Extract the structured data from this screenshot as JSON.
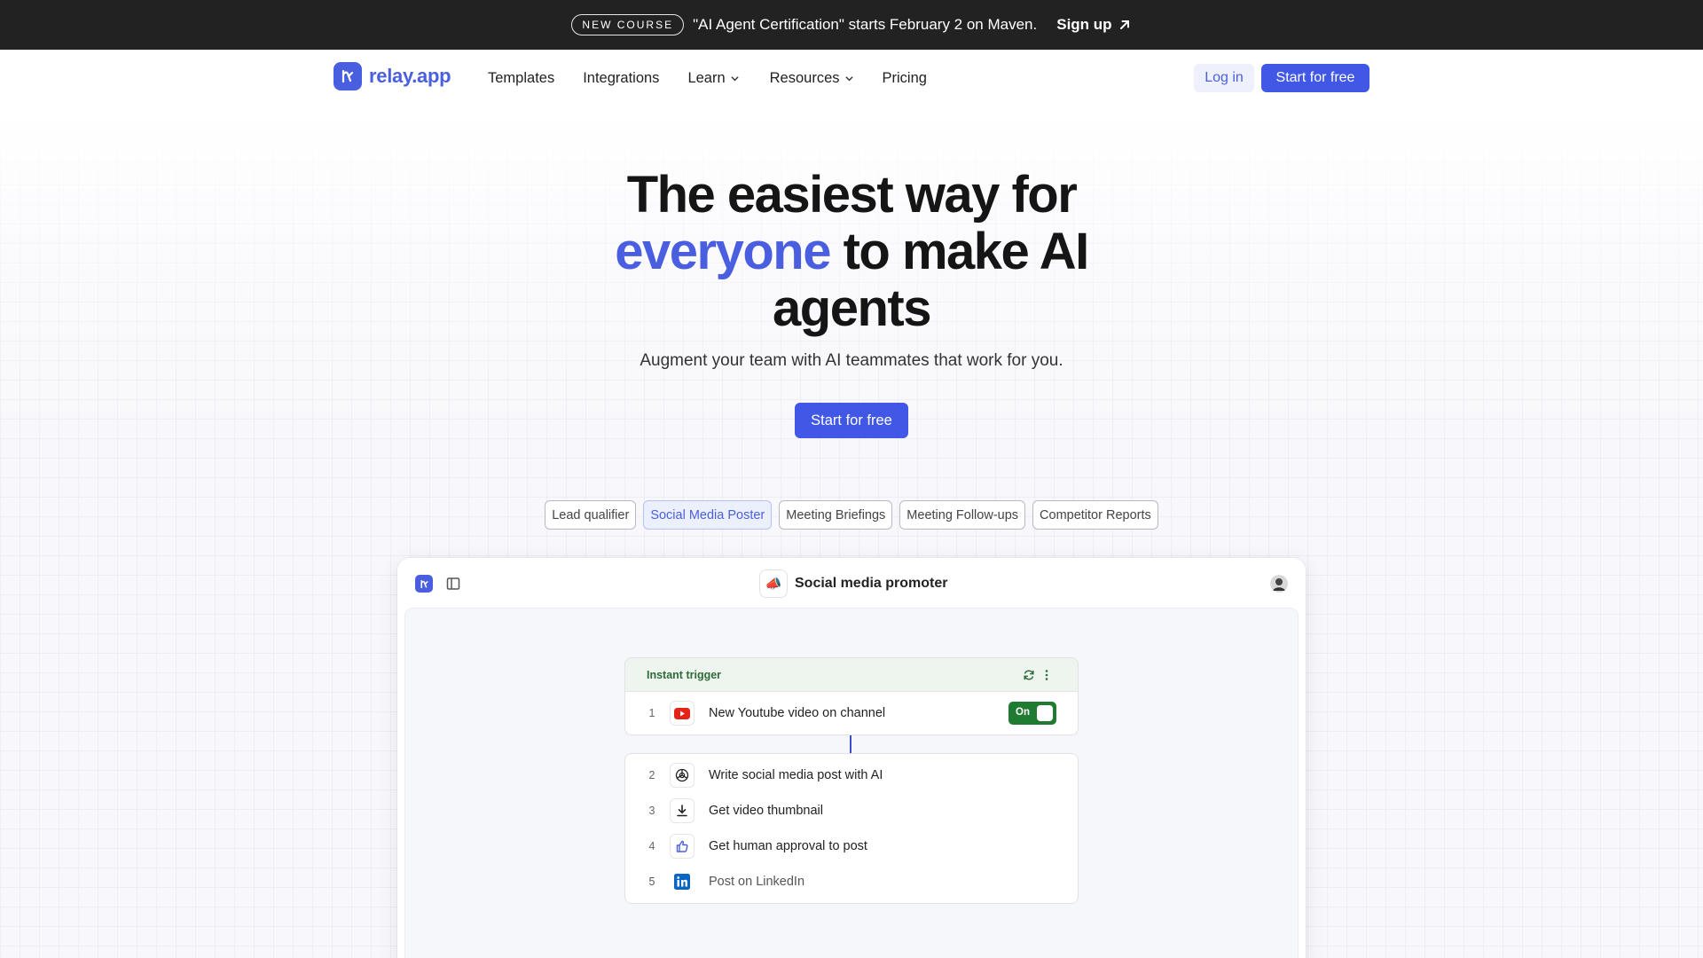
{
  "announcement": {
    "badge": "NEW COURSE",
    "message": "\"AI Agent Certification\" starts February 2 on Maven.",
    "cta": "Sign up"
  },
  "nav": {
    "logo_text": "relay.app",
    "links": [
      {
        "label": "Templates",
        "has_dropdown": false
      },
      {
        "label": "Integrations",
        "has_dropdown": false
      },
      {
        "label": "Learn",
        "has_dropdown": true
      },
      {
        "label": "Resources",
        "has_dropdown": true
      },
      {
        "label": "Pricing",
        "has_dropdown": false
      }
    ],
    "login": "Log in",
    "start": "Start for free"
  },
  "hero": {
    "headline_line1": "The easiest way for",
    "headline_accent": "everyone",
    "headline_line2_rest": " to make AI",
    "headline_line3": "agents",
    "subhead": "Augment your team with AI teammates that work for you.",
    "cta": "Start for free"
  },
  "tabs": [
    {
      "label": "Lead qualifier",
      "active": false
    },
    {
      "label": "Social Media Poster",
      "active": true
    },
    {
      "label": "Meeting Briefings",
      "active": false
    },
    {
      "label": "Meeting Follow-ups",
      "active": false
    },
    {
      "label": "Competitor Reports",
      "active": false
    }
  ],
  "window": {
    "title": "Social media promoter",
    "title_emoji": "📣"
  },
  "flow": {
    "trigger_label": "Instant trigger",
    "toggle_label": "On",
    "steps": [
      {
        "num": "1",
        "text": "New Youtube video on channel",
        "icon": "youtube-icon"
      },
      {
        "num": "2",
        "text": "Write social media post with AI",
        "icon": "openai-icon"
      },
      {
        "num": "3",
        "text": "Get video thumbnail",
        "icon": "download-icon"
      },
      {
        "num": "4",
        "text": "Get human approval to post",
        "icon": "thumbs-up-icon"
      },
      {
        "num": "5",
        "text": "Post on LinkedIn",
        "icon": "linkedin-icon"
      }
    ]
  },
  "colors": {
    "brand": "#4a5fe0",
    "primary_button": "#4158e6",
    "announcement_bg": "#222222",
    "toggle_on": "#1f7a32",
    "youtube_red": "#e62117",
    "linkedin_blue": "#0a66c2"
  }
}
